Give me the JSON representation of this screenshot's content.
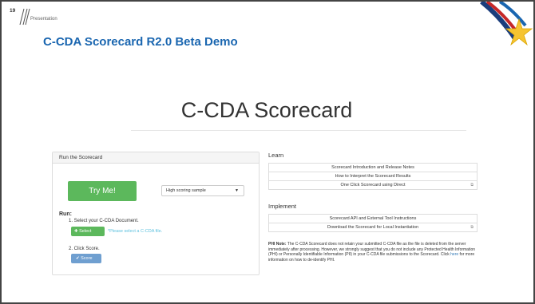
{
  "slide": {
    "number": "19",
    "section": "Presentation",
    "title": "C-CDA Scorecard R2.0 Beta Demo"
  },
  "app": {
    "title": "C-CDA Scorecard",
    "run_panel": {
      "heading": "Run the Scorecard",
      "try_button": "Try Me!",
      "sample_select": {
        "selected": "High scoring sample"
      },
      "run_label": "Run:",
      "step1": "1. Select your C-CDA Document.",
      "select_button": "Select",
      "select_hint": "*Please select a C-CDA file.",
      "step2": "2. Click Score.",
      "score_button": "Score"
    },
    "learn": {
      "title": "Learn",
      "links": [
        "Scorecard Introduction and Release Notes",
        "How to Interpret the Scorecard Results",
        "One Click Scorecard using Direct"
      ]
    },
    "implement": {
      "title": "Implement",
      "links": [
        "Scorecard API and External Tool Instructions",
        "Download the Scorecard for Local Instantiation"
      ]
    },
    "phi_note": {
      "label": "PHI Note:",
      "text1": " The C-CDA Scorecard does not retain your submitted C-CDA file as the file is deleted from the server immediately after processing. However, we strongly suggest that you do not include any Protected Health Information (PHI) or Personally Identifiable Information (PII) in your C-CDA file submissions to the Scorecard. Click ",
      "link": "here",
      "text2": " for more information on how to de-identify PHI."
    }
  },
  "colors": {
    "title_blue": "#1a66b0",
    "green_button": "#5cb85c",
    "score_button": "#6f9fd0",
    "hint": "#5bc0de"
  }
}
